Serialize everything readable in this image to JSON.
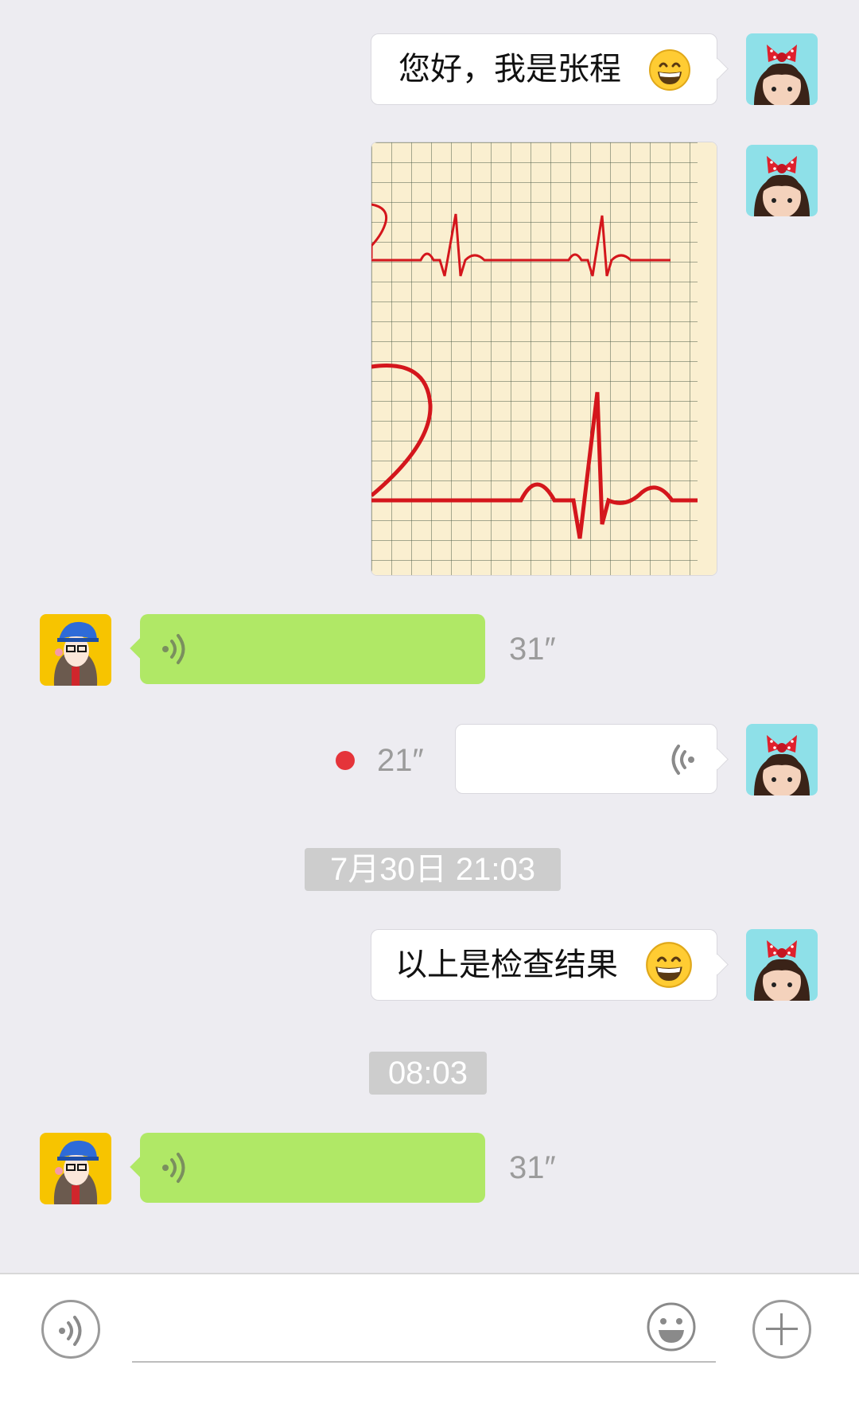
{
  "messages": [
    {
      "type": "text",
      "side": "right",
      "text": "您好，我是张程",
      "emoji": "grinning-face"
    },
    {
      "type": "image",
      "side": "right",
      "content": "ecg-heartbeat-graph"
    },
    {
      "type": "voice",
      "side": "left",
      "duration": "31″"
    },
    {
      "type": "voice",
      "side": "right",
      "duration": "21″",
      "unread": true
    },
    {
      "type": "timestamp",
      "text": "7月30日 21:03"
    },
    {
      "type": "text",
      "side": "right",
      "text": "以上是检查结果",
      "emoji": "grinning-face"
    },
    {
      "type": "timestamp",
      "text": "08:03"
    },
    {
      "type": "voice",
      "side": "left",
      "duration": "31″"
    }
  ],
  "input_bar": {
    "voice_button_icon": "voice-icon",
    "emoji_button_icon": "smile-icon",
    "plus_button_icon": "plus-icon",
    "text_value": ""
  },
  "colors": {
    "background": "#EDECF1",
    "green_bubble": "#B0E866",
    "white_bubble": "#FFFFFF",
    "unread_dot": "#E5343A",
    "ecg_line": "#D4161C",
    "ecg_paper": "#FAEFD0"
  }
}
